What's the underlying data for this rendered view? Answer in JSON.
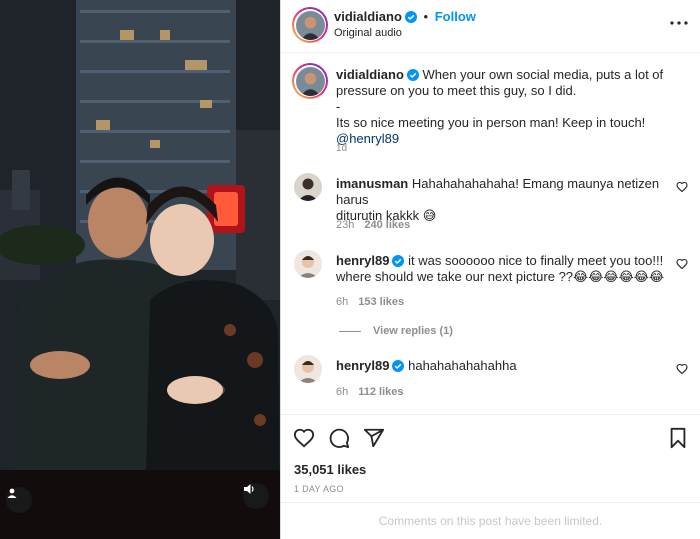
{
  "post": {
    "author": "vidialdiano",
    "follow_label": "Follow",
    "separator": "•",
    "audio": "Original audio",
    "caption_lines": [
      "When your own social media, puts a lot of",
      "pressure on you to meet this guy, so I did.",
      "-",
      "Its so nice meeting you in person man! Keep in touch!"
    ],
    "caption_mention": "@henryl89",
    "caption_time": "1d",
    "likes": "35,051 likes",
    "date": "1 DAY AGO",
    "comments_limited": "Comments on this post have been limited."
  },
  "comments": [
    {
      "user": "imanusman",
      "text_line1": "Hahahahahahaha! Emang maunya netizen harus",
      "text_line2": "diturutin kakkk 😅",
      "time": "23h",
      "likes": "240 likes"
    },
    {
      "user": "henryl89",
      "text_line1": "it was soooooo nice to finally meet you too!!!",
      "text_line2": "where should we take our next picture ??😂😂😂😂😂😂",
      "time": "6h",
      "likes": "153 likes",
      "view_replies": "View replies (1)"
    },
    {
      "user": "henryl89",
      "text_line1": "hahahahahahahha",
      "time": "6h",
      "likes": "112 likes"
    }
  ],
  "colors": {
    "accent": "#0095f6",
    "verified": "#0095f6",
    "muted": "#8e8e8e",
    "mention": "#00376b"
  },
  "icons": [
    "verified-badge-icon",
    "more-options-icon",
    "heart-icon",
    "comment-icon",
    "share-icon",
    "bookmark-icon",
    "user-tag-icon",
    "audio-icon"
  ]
}
